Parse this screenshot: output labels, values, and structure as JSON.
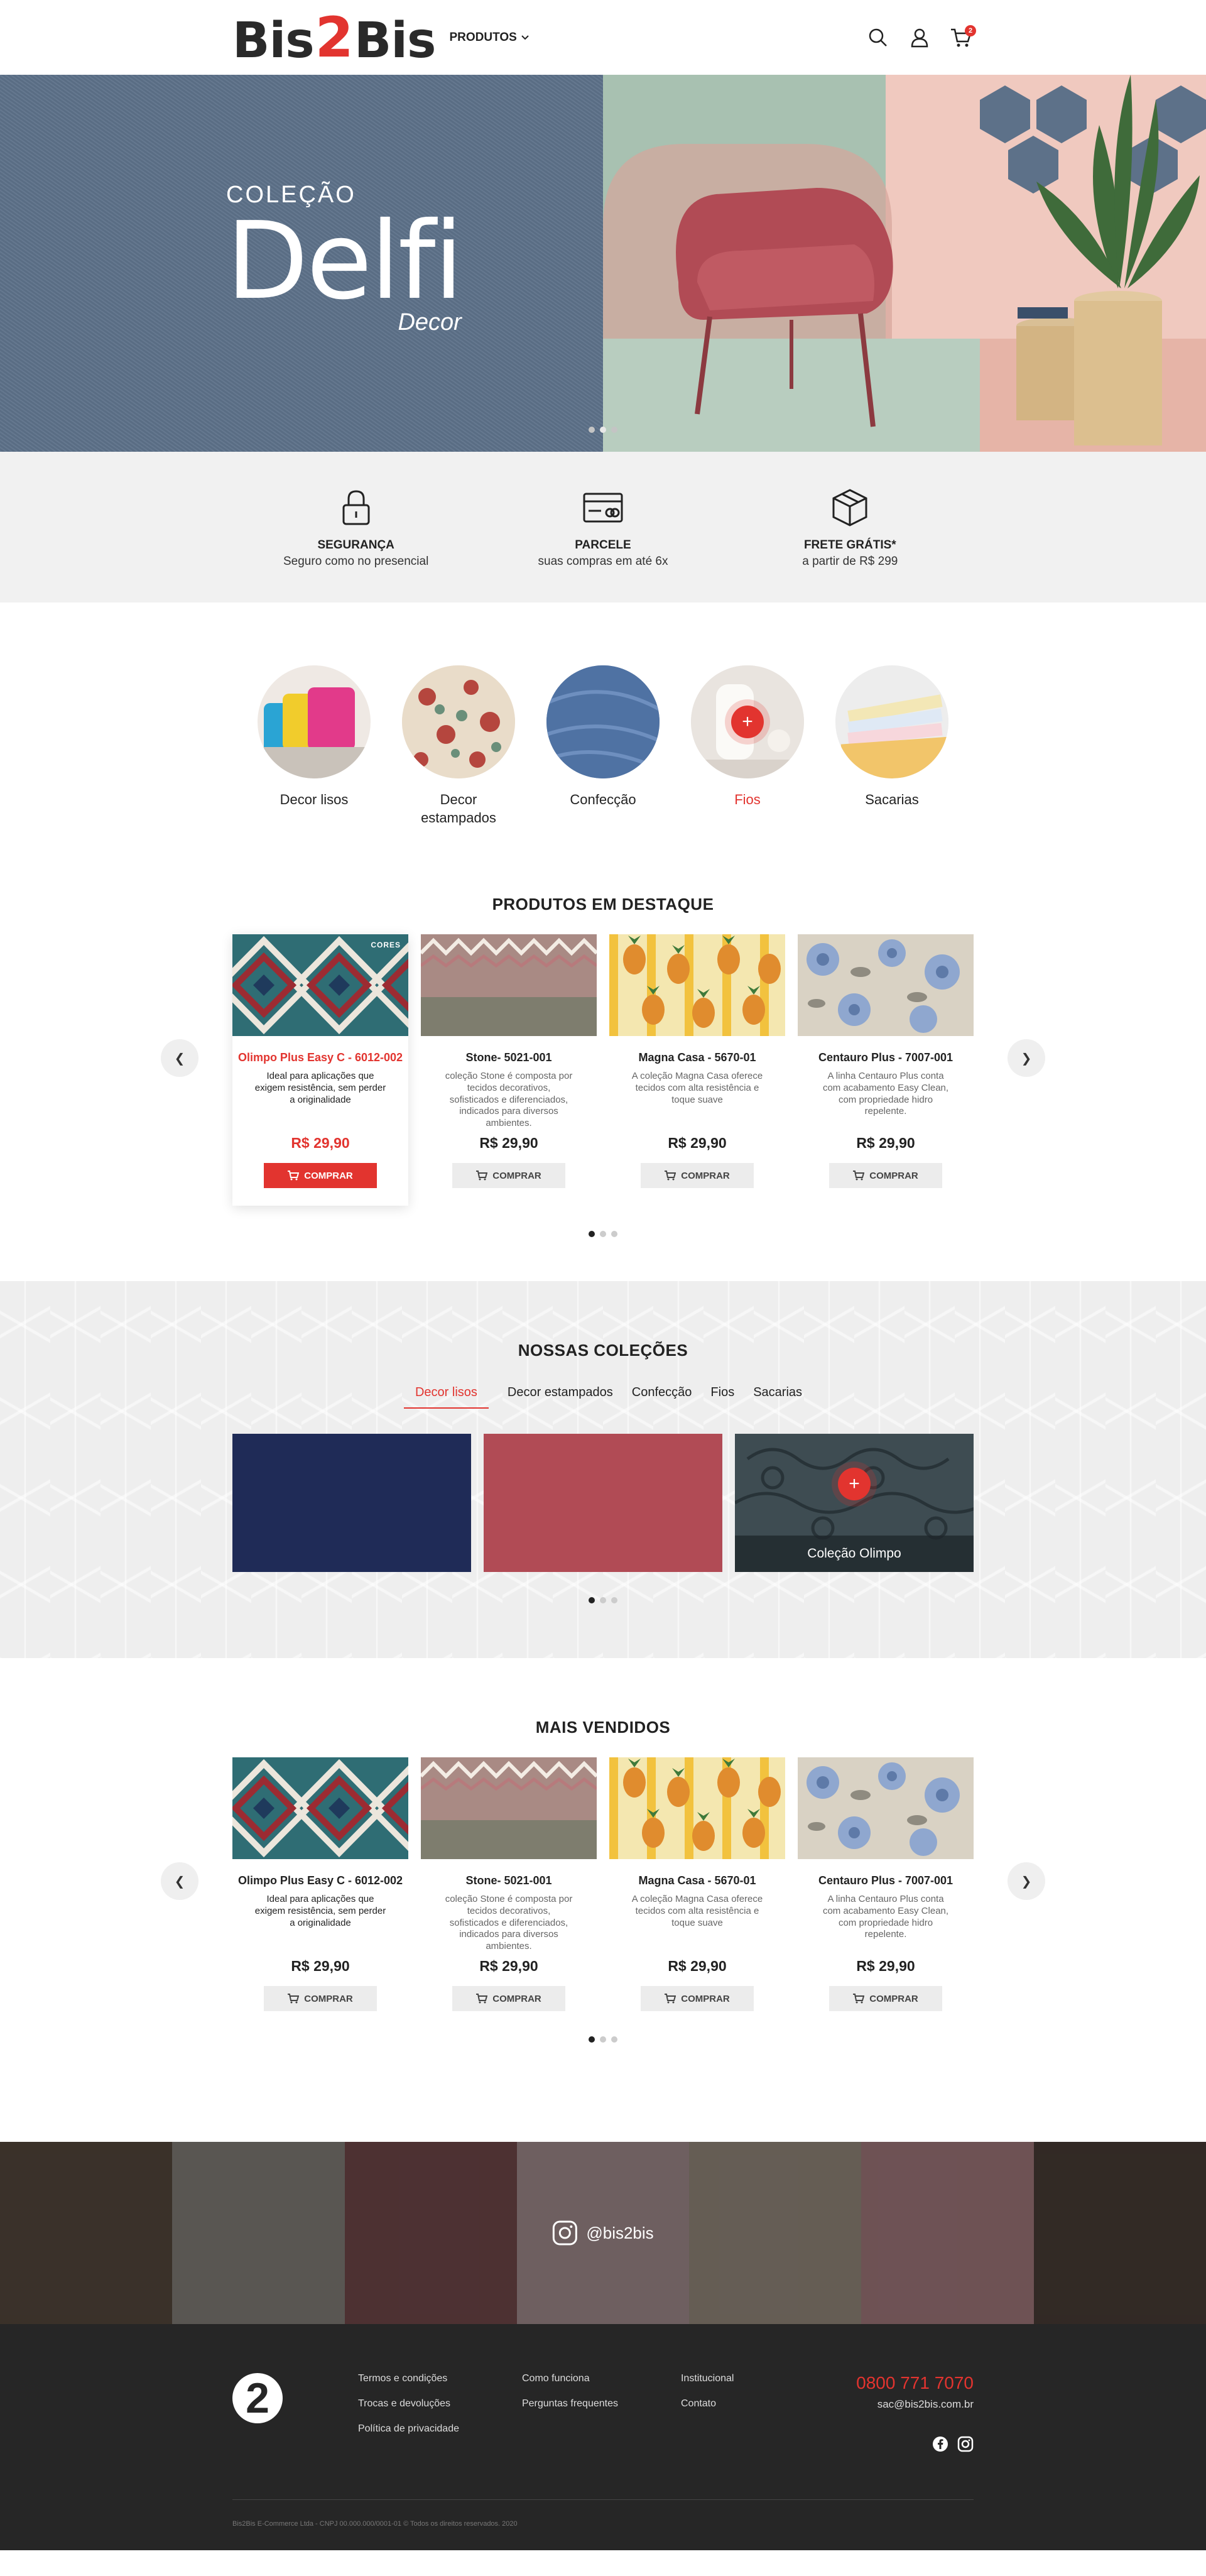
{
  "header": {
    "logo_left": "Bis",
    "logo_mid": "2",
    "logo_right": "Bis",
    "nav_products": "PRODUTOS",
    "cart_count": "2"
  },
  "hero": {
    "kicker": "COLEÇÃO",
    "title": "Delfi",
    "subtitle": "Decor",
    "slide_count": 3,
    "active_slide": 2
  },
  "features": [
    {
      "title": "SEGURANÇA",
      "sub": "Seguro como no presencial",
      "icon": "lock-icon"
    },
    {
      "title": "PARCELE",
      "sub": "suas compras em até 6x",
      "icon": "credit-card-icon"
    },
    {
      "title": "FRETE GRÁTIS*",
      "sub": "a partir de R$ 299",
      "icon": "box-icon"
    }
  ],
  "categories": [
    {
      "label": "Decor lisos"
    },
    {
      "label": "Decor\nestampados"
    },
    {
      "label": "Confecção"
    },
    {
      "label": "Fios",
      "active": true
    },
    {
      "label": "Sacarias"
    }
  ],
  "featured": {
    "title_bold": "PRODUTOS",
    "title_rest": " EM DESTAQUE",
    "items": [
      {
        "tag": "CORES",
        "name": "Olimpo Plus Easy C - 6012-002",
        "desc": "Ideal para aplicações que exigem resistência, sem perder a originalidade",
        "price": "R$ 29,90",
        "buy": "COMPRAR"
      },
      {
        "name": "Stone- 5021-001",
        "desc": "coleção Stone é composta por tecidos decorativos, sofisticados e diferenciados, indicados para diversos ambientes.",
        "price": "R$ 29,90",
        "buy": "COMPRAR"
      },
      {
        "name": "Magna Casa - 5670-01",
        "desc": "A coleção Magna Casa oferece tecidos com alta resistência e toque suave",
        "price": "R$ 29,90",
        "buy": "COMPRAR"
      },
      {
        "name": "Centauro Plus - 7007-001",
        "desc": "A linha Centauro Plus conta com acabamento Easy Clean, com propriedade hidro repelente.",
        "price": "R$ 29,90",
        "buy": "COMPRAR"
      }
    ]
  },
  "collections": {
    "title_bold": "NOSSAS",
    "title_rest": " COLEÇÕES",
    "tabs": [
      "Decor lisos",
      "Decor estampados",
      "Confecção",
      "Fios",
      "Sacarias"
    ],
    "card_label": "Coleção Olimpo",
    "colors": [
      "#1f2b57",
      "#b14b55",
      "#3e4c52"
    ]
  },
  "bestsellers": {
    "title_bold": "MAIS",
    "title_rest": " VENDIDOS",
    "items": [
      {
        "name": "Olimpo Plus Easy C - 6012-002",
        "desc": "Ideal para aplicações que exigem resistência, sem perder a originalidade",
        "price": "R$ 29,90",
        "buy": "COMPRAR"
      },
      {
        "name": "Stone- 5021-001",
        "desc": "coleção Stone é composta por tecidos decorativos, sofisticados e diferenciados, indicados para diversos ambientes.",
        "price": "R$ 29,90",
        "buy": "COMPRAR"
      },
      {
        "name": "Magna Casa - 5670-01",
        "desc": "A coleção Magna Casa oferece tecidos com alta resistência e toque suave",
        "price": "R$ 29,90",
        "buy": "COMPRAR"
      },
      {
        "name": "Centauro Plus - 7007-001",
        "desc": "A linha Centauro Plus conta com acabamento Easy Clean, com propriedade hidro repelente.",
        "price": "R$ 29,90",
        "buy": "COMPRAR"
      }
    ]
  },
  "instagram": {
    "handle": "@bis2bis"
  },
  "footer": {
    "col1": [
      "Termos e condições",
      "Trocas e devoluções",
      "Política de privacidade"
    ],
    "col2": [
      "Como funciona",
      "Perguntas frequentes"
    ],
    "col3": [
      "Institucional",
      "Contato"
    ],
    "phone": "0800 771 7070",
    "email": "sac@bis2bis.com.br",
    "copyright": "Bis2Bis E-Commerce Ltda - CNPJ 00.000.000/0001-01 © Todos os direitos reservados. 2020"
  },
  "colors": {
    "brand_red": "#e2342f",
    "hero_blue": "#5d7189",
    "footer_bg": "#262626"
  }
}
